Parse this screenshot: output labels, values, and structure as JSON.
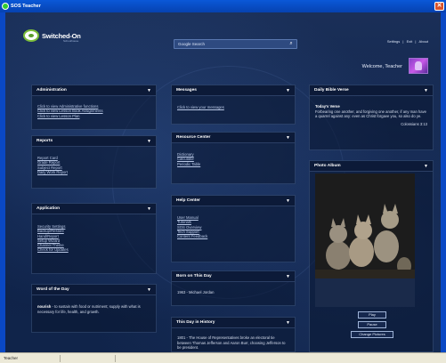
{
  "window": {
    "title": "SOS Teacher"
  },
  "header": {
    "logo_text": "Switched-On",
    "logo_sub": "Schoolhouse",
    "search_placeholder": "Google Search",
    "links": [
      "Settings",
      "|",
      "Exit",
      "|",
      "About"
    ],
    "welcome": "Welcome, Teacher"
  },
  "panels": {
    "administration": {
      "title": "Administration",
      "links": [
        "Click to view Administrative functions",
        "Click to view Lesson Book Assignments",
        "Click to view Lesson Plan"
      ]
    },
    "reports": {
      "title": "Reports",
      "links": [
        "Report Card",
        "Grade Report",
        "Subject Report",
        "Daily Work Report"
      ]
    },
    "application": {
      "title": "Application",
      "links": [
        "Security Settings",
        "Backup/Restore",
        "Hand/Report",
        "Setup Wizard",
        "Channel Theme",
        "Check for Updates"
      ]
    },
    "word": {
      "title": "Word of the Day",
      "word": "nourish",
      "definition": " - to sustain with food or nutriment; supply with what is necessary for life, health, and growth."
    },
    "messages": {
      "title": "Messages",
      "link": "Click to view your messages"
    },
    "resource": {
      "title": "Resource Center",
      "links": [
        "Dictionary",
        "Calculator",
        "Periodic Table"
      ]
    },
    "help": {
      "title": "Help Center",
      "links": [
        "User Manual",
        "Tutorials",
        "SOS Overview",
        "Tech Support",
        "Content Feedback"
      ]
    },
    "born": {
      "title": "Born on This Day",
      "text": "1963 - Michael Jordan"
    },
    "history": {
      "title": "This Day in History",
      "text": "1801 - The House of Representatives broke an electoral tie between Thomas Jefferson and Aaron Burr, choosing Jefferson to be president."
    },
    "verse": {
      "title": "Daily Bible Verse",
      "heading": "Today's Verse",
      "text": "Forbearing one another, and forgiving one another, if any man have a quarrel against any: even as Christ forgave you, so also do ye.",
      "ref": "Colossians 3:13"
    },
    "photo": {
      "title": "Photo Album",
      "buttons": [
        "Play",
        "Pause",
        "Change Pictures"
      ]
    }
  },
  "statusbar": {
    "text": "Teacher"
  }
}
